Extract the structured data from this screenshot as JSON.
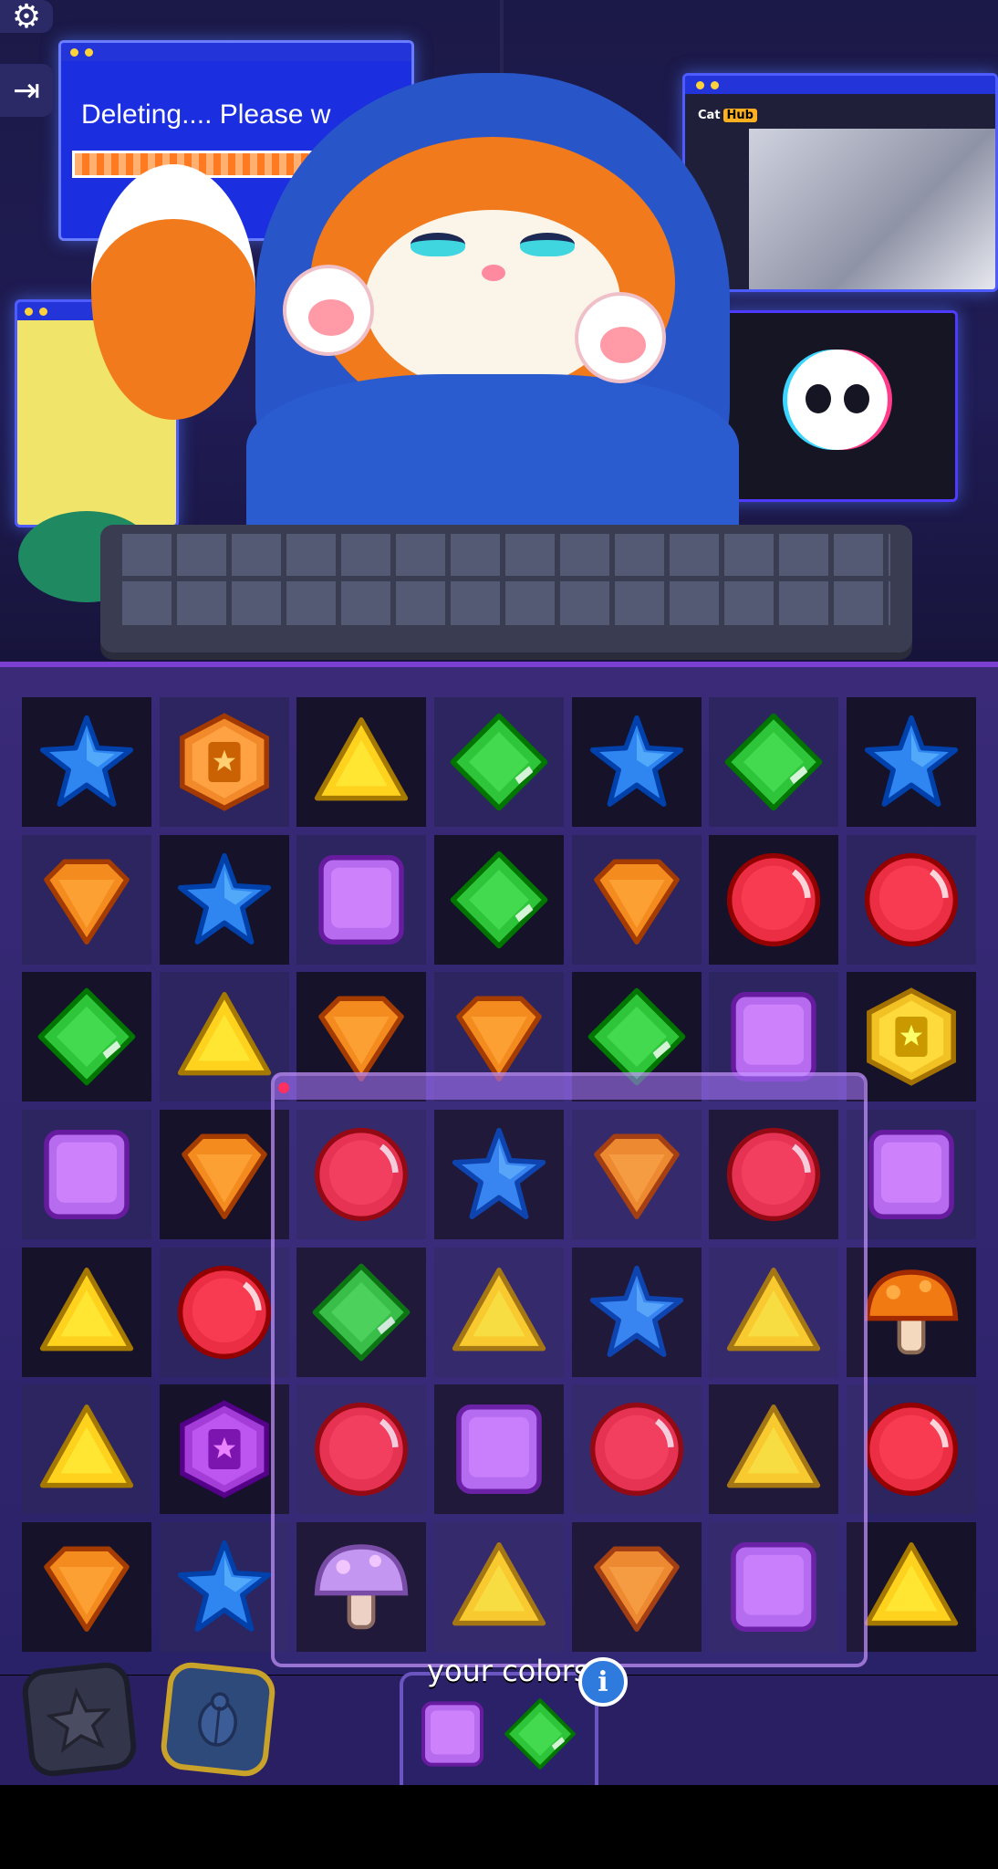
{
  "scene": {
    "delete_window_text": "Deleting.... Please w",
    "cathub_brand": "Cat",
    "cathub_hub": "Hub"
  },
  "side_buttons": [
    {
      "icon": "gear-icon"
    },
    {
      "icon": "exit-icon"
    }
  ],
  "board": {
    "rows": 7,
    "cols": 7,
    "pattern": [
      [
        "d",
        "l",
        "d",
        "l",
        "d",
        "l",
        "d"
      ],
      [
        "l",
        "d",
        "l",
        "d",
        "l",
        "d",
        "l"
      ],
      [
        "d",
        "l",
        "d",
        "l",
        "d",
        "l",
        "d"
      ],
      [
        "l",
        "d",
        "l",
        "d",
        "l",
        "d",
        "l"
      ],
      [
        "d",
        "l",
        "d",
        "l",
        "d",
        "l",
        "d"
      ],
      [
        "l",
        "d",
        "l",
        "d",
        "l",
        "d",
        "l"
      ],
      [
        "d",
        "l",
        "d",
        "l",
        "d",
        "l",
        "d"
      ]
    ],
    "grid": [
      [
        "blue-star",
        "orange-book-token",
        "yellow-triangle",
        "green-diamond",
        "blue-star",
        "green-diamond",
        "blue-star"
      ],
      [
        "orange-shield",
        "blue-star",
        "purple-square",
        "green-diamond",
        "orange-shield",
        "red-circle",
        "red-circle"
      ],
      [
        "green-diamond",
        "yellow-triangle",
        "orange-shield",
        "orange-shield",
        "green-diamond",
        "purple-square",
        "gold-book-token"
      ],
      [
        "purple-square",
        "orange-shield",
        "red-circle",
        "blue-star",
        "orange-shield",
        "red-circle",
        "purple-square"
      ],
      [
        "yellow-triangle",
        "red-circle",
        "green-diamond",
        "yellow-triangle",
        "blue-star",
        "yellow-triangle",
        "orange-mushroom"
      ],
      [
        "yellow-triangle",
        "purple-book-token",
        "red-circle",
        "purple-square",
        "red-circle",
        "yellow-triangle",
        "red-circle"
      ],
      [
        "orange-shield",
        "blue-star",
        "purple-mushroom",
        "yellow-triangle",
        "orange-shield",
        "purple-square",
        "yellow-triangle"
      ]
    ]
  },
  "bottom": {
    "boosters": [
      {
        "icon": "star-booster-icon"
      },
      {
        "icon": "scarab-booster-icon"
      }
    ],
    "colors_label": "your colors",
    "info_label": "i",
    "your_colors": [
      "purple-square",
      "green-diamond"
    ]
  },
  "colors": {
    "blue": "#2f86f0",
    "orange": "#f48b1f",
    "yellow": "#ffd21e",
    "green": "#2fc53a",
    "red": "#ec2e45",
    "purple": "#b76cf0",
    "board_bg": "#2a2268"
  }
}
